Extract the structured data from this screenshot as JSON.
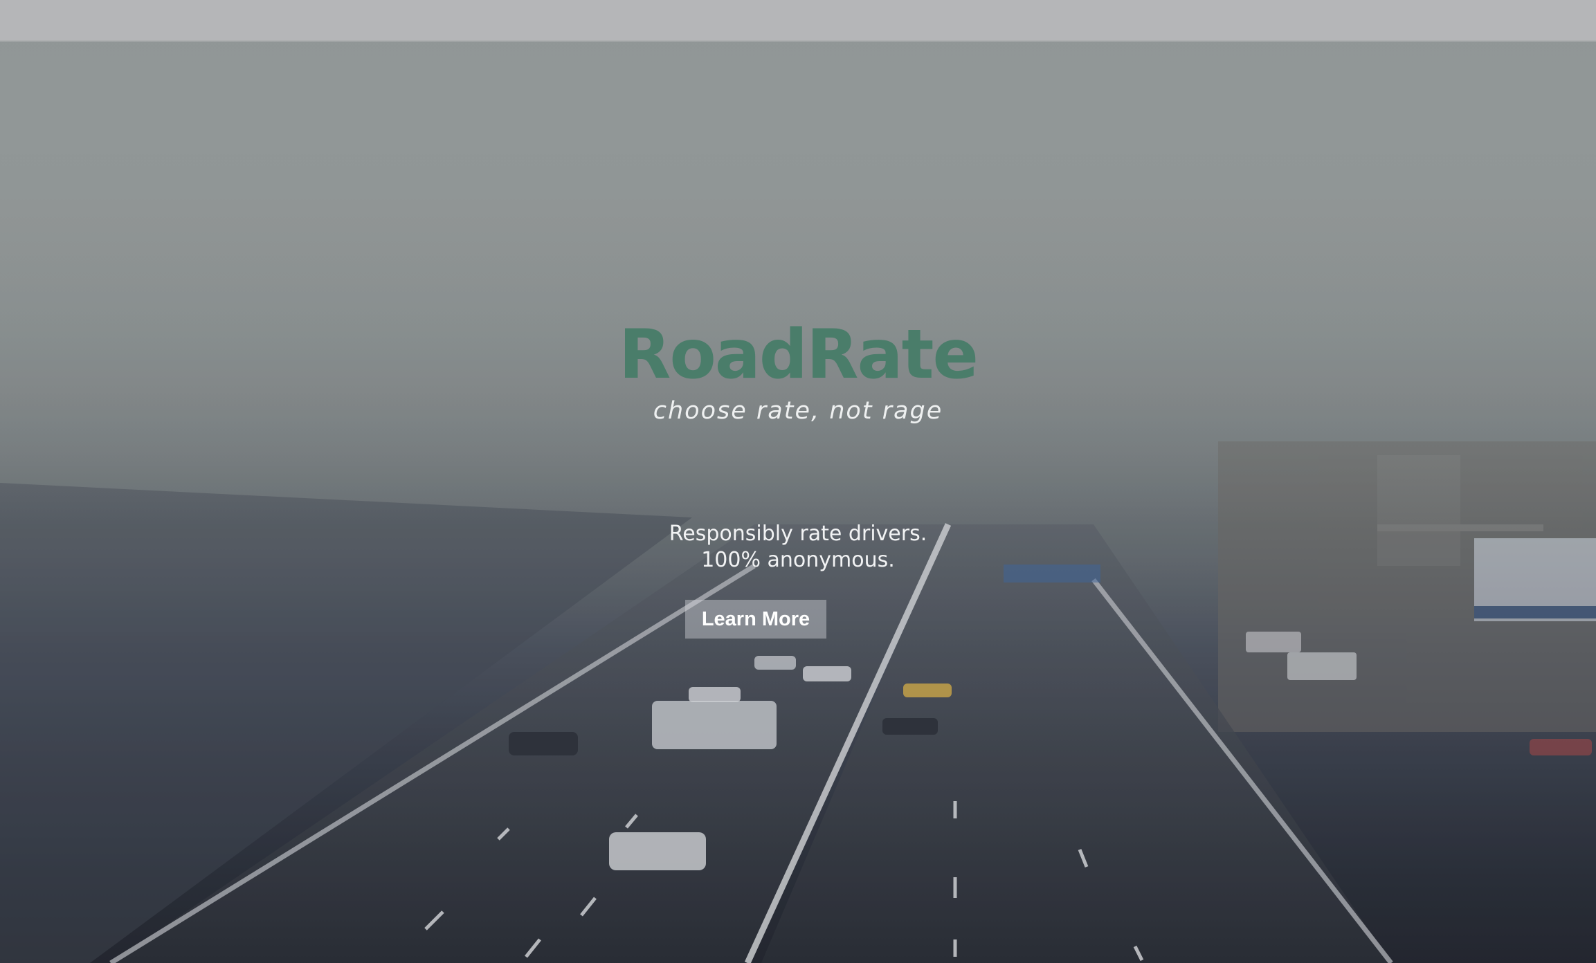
{
  "brand": {
    "title": "RoadRate",
    "tagline": "choose rate, not rage"
  },
  "hero": {
    "description_line1": "Responsibly rate drivers.",
    "description_line2": "100% anonymous.",
    "cta_label": "Learn More"
  },
  "colors": {
    "brand_green": "#4a7d6a",
    "navbar": "#b5b6b8"
  }
}
